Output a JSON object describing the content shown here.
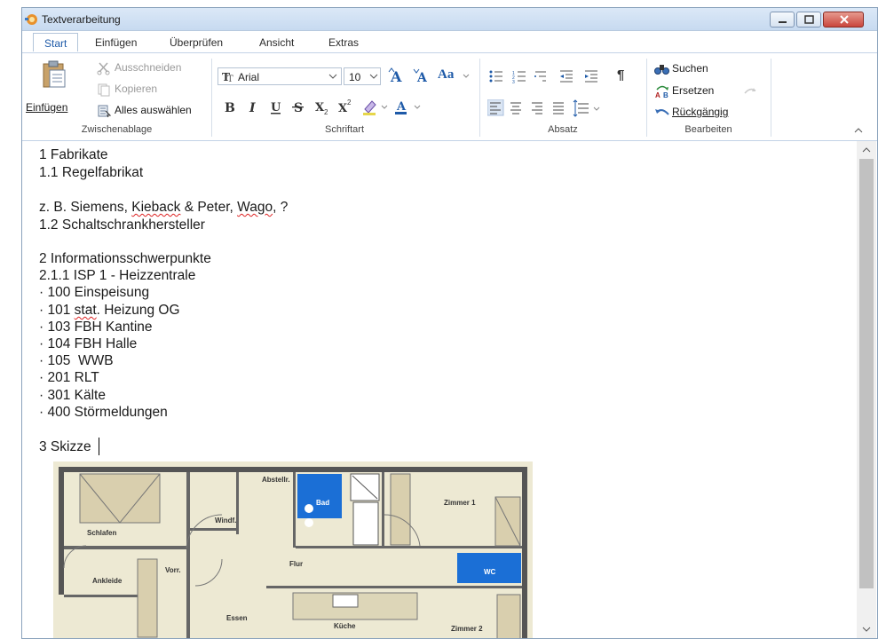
{
  "window": {
    "title": "Textverarbeitung"
  },
  "tabs": [
    {
      "label": "Start",
      "active": true
    },
    {
      "label": "Einfügen",
      "active": false
    },
    {
      "label": "Überprüfen",
      "active": false
    },
    {
      "label": "Ansicht",
      "active": false
    },
    {
      "label": "Extras",
      "active": false
    }
  ],
  "ribbon": {
    "clipboard": {
      "paste": "Einfügen",
      "cut": "Ausschneiden",
      "copy": "Kopieren",
      "select_all": "Alles auswählen",
      "group_label": "Zwischenablage"
    },
    "font": {
      "font_name": "Arial",
      "font_size": "10",
      "change_case": "Aa",
      "group_label": "Schriftart"
    },
    "paragraph": {
      "group_label": "Absatz",
      "pilcrow": "¶"
    },
    "editing": {
      "find": "Suchen",
      "replace": "Ersetzen",
      "undo": "Rückgängig",
      "group_label": "Bearbeiten"
    }
  },
  "document": {
    "lines": [
      "1 Fabrikate",
      "1.1 Regelfabrikat",
      "z. B. Siemens, Kieback & Peter, Wago, ?",
      "1.2 Schaltschrankhersteller",
      "2 Informationsschwerpunkte",
      "2.1.1 ISP 1 - Heizzentrale",
      "· 100 Einspeisung",
      "· 101 stat. Heizung OG",
      "· 103 FBH Kantine",
      "· 104 FBH Halle",
      "· 105  WWB",
      "· 201 RLT",
      "· 301 Kälte",
      "· 400 Störmeldungen",
      "3 Skizze"
    ],
    "floorplan_labels": {
      "abstell": "Abstellr.",
      "bad": "Bad",
      "zimmer1": "Zimmer 1",
      "schlafen": "Schlafen",
      "windf": "Windf.",
      "vorr": "Vorr.",
      "flur": "Flur",
      "wc": "WC",
      "ankleide": "Ankleide",
      "essen": "Essen",
      "kueche": "Küche",
      "zimmer2": "Zimmer 2"
    }
  },
  "colors": {
    "accent": "#1e5aa8",
    "close_button": "#c9463d",
    "bath_blue": "#1b6fd6"
  }
}
